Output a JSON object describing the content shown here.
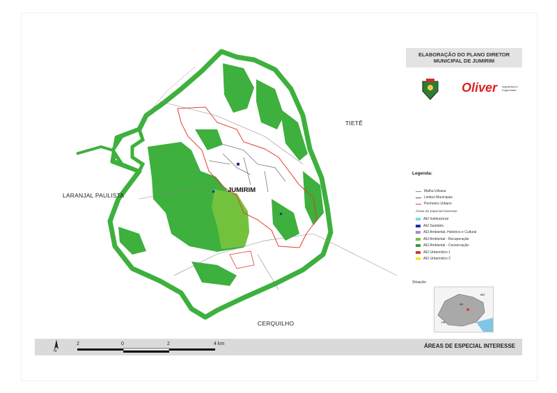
{
  "map": {
    "neighbors": {
      "tiete": "TIETÊ",
      "laranjal": "LARANJAL PAULISTA",
      "cerquilho": "CERQUILHO"
    },
    "city": "JUMIRIM",
    "colors": {
      "conservacao": "#3db03d",
      "recuperacao": "#72c23e",
      "perimetro": "#e33b2d",
      "limite": "#555555"
    }
  },
  "panel": {
    "title_line1": "ELABORAÇÃO DO PLANO DIRETOR",
    "title_line2": "MUNICIPAL DE JUMIRIM",
    "logo_text": "Oliver",
    "logo_sub1": "Arquitetura e",
    "logo_sub2": "Engenharia",
    "legend_title": "Legenda:",
    "legend_lines": [
      {
        "label": "Malha Urbana",
        "color": "#888888"
      },
      {
        "label": "Limites Municipais",
        "color": "#555555"
      },
      {
        "label": "Perímetro Urbano",
        "color": "#e33b2d"
      }
    ],
    "legend_subtitle": "Áreas de Especial Interesse",
    "legend_areas": [
      {
        "label": "AEI Institucional",
        "color": "#7fd6e8"
      },
      {
        "label": "AEI Sanitário",
        "color": "#1f2fa0"
      },
      {
        "label": "AEI Ambiental, Histórico e Cultural",
        "color": "#a98acb"
      },
      {
        "label": "AEI Ambiental - Recuperação",
        "color": "#72c23e"
      },
      {
        "label": "AEI Ambiental - Conservação",
        "color": "#2f9e3a"
      },
      {
        "label": "AEI Urbanístico 1",
        "color": "#d33a2a"
      },
      {
        "label": "AEI Urbanístico 2",
        "color": "#f4e63a"
      }
    ],
    "situacao": "Situação:",
    "inset_labels": {
      "mg": "MG",
      "sp": "SP",
      "pr": "PR"
    }
  },
  "footer": {
    "title": "ÁREAS DE ESPECIAL INTERESSE",
    "north": "N",
    "scale_labels": [
      "2",
      "0",
      "2",
      "4 km"
    ]
  }
}
